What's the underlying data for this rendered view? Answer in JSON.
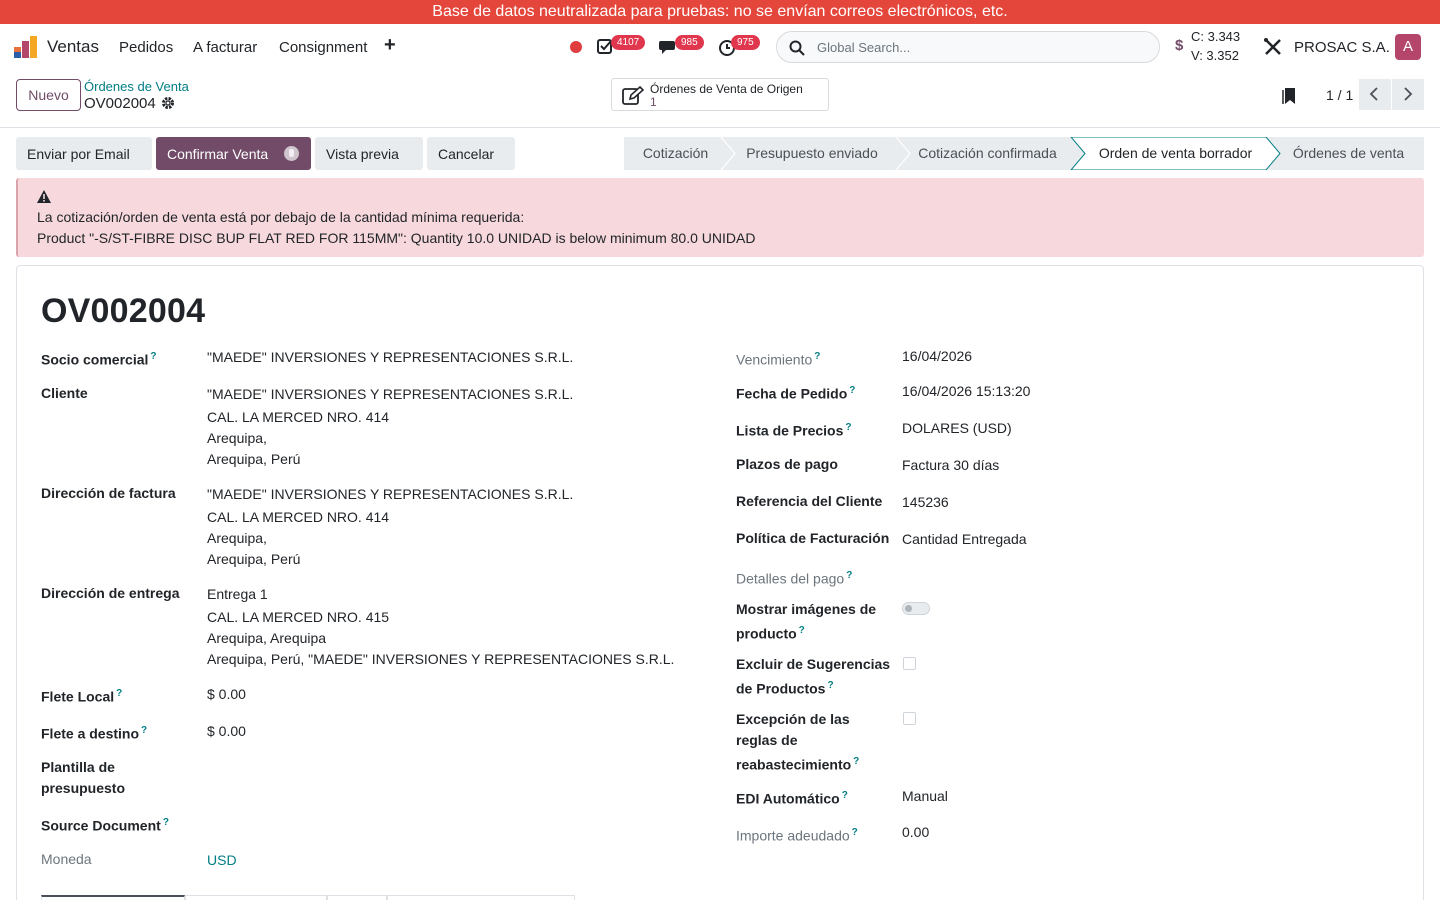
{
  "banner": "Base de datos neutralizada para pruebas: no se envían correos electrónicos, etc.",
  "navbar": {
    "app_name": "Ventas",
    "menu": [
      "Pedidos",
      "A facturar",
      "Consignment"
    ],
    "badges": {
      "activities": "4107",
      "messages": "985",
      "clock": "975"
    },
    "search_placeholder": "Global Search...",
    "currency_symbol": "$",
    "rate_buy": "C: 3.343",
    "rate_sell": "V: 3.352",
    "company": "PROSAC S.A.",
    "avatar_letter": "A"
  },
  "control": {
    "new_label": "Nuevo",
    "breadcrumb_parent": "Órdenes de Venta",
    "breadcrumb_current": "OV002004",
    "smart_button_label": "Órdenes de Venta de Origen",
    "smart_button_count": "1",
    "pager": "1 / 1"
  },
  "actions": [
    "Enviar por Email",
    "Confirmar Venta",
    "Vista previa",
    "Cancelar"
  ],
  "stages": [
    {
      "label": "Cotización",
      "active": false
    },
    {
      "label": "Presupuesto enviado",
      "active": false
    },
    {
      "label": "Cotización confirmada",
      "active": false
    },
    {
      "label": "Orden de venta borrador",
      "active": true
    },
    {
      "label": "Órdenes de venta",
      "active": false
    }
  ],
  "alert": {
    "line1": "La cotización/orden de venta está por debajo de la cantidad mínima requerida:",
    "line2": "Product \"-S/ST-FIBRE DISC BUP FLAT RED FOR 115MM\": Quantity 10.0 UNIDAD is below minimum 80.0 UNIDAD"
  },
  "form": {
    "title": "OV002004",
    "left": {
      "socio_label": "Socio comercial",
      "socio_value": "\"MAEDE\" INVERSIONES Y REPRESENTACIONES S.R.L.",
      "cliente_label": "Cliente",
      "cliente_lines": [
        "\"MAEDE\" INVERSIONES Y REPRESENTACIONES S.R.L.",
        "CAL. LA MERCED NRO. 414",
        "Arequipa,",
        "Arequipa, Perú"
      ],
      "factura_label": "Dirección de factura",
      "factura_lines": [
        "\"MAEDE\" INVERSIONES Y REPRESENTACIONES S.R.L.",
        "CAL. LA MERCED NRO. 414",
        "Arequipa,",
        "Arequipa, Perú"
      ],
      "entrega_label": "Dirección de entrega",
      "entrega_lines": [
        "Entrega 1",
        "CAL. LA MERCED NRO. 415",
        "Arequipa, Arequipa",
        "Arequipa, Perú, \"MAEDE\" INVERSIONES Y REPRESENTACIONES S.R.L."
      ],
      "flete_local_label": "Flete Local",
      "flete_local_value": "$ 0.00",
      "flete_destino_label": "Flete a destino",
      "flete_destino_value": "$ 0.00",
      "plantilla_label_1": "Plantilla de",
      "plantilla_label_2": "presupuesto",
      "source_label": "Source Document",
      "moneda_label": "Moneda",
      "moneda_value": "USD"
    },
    "right": {
      "vencimiento_label": "Vencimiento",
      "vencimiento_value": "16/04/2026",
      "fecha_label": "Fecha de Pedido",
      "fecha_value": "16/04/2026 15:13:20",
      "lista_label": "Lista de Precios",
      "lista_value": "DOLARES (USD)",
      "plazos_label": "Plazos de pago",
      "plazos_value": "Factura 30 días",
      "referencia_label": "Referencia del Cliente",
      "referencia_value": "145236",
      "politica_label": "Política de Facturación",
      "politica_value": "Cantidad Entregada",
      "detalles_label": "Detalles del pago",
      "mostrar_label_1": "Mostrar imágenes de",
      "mostrar_label_2": "producto",
      "mostrar_checked": false,
      "excluir_label_1": "Excluir de Sugerencias",
      "excluir_label_2": "de Productos",
      "excluir_checked": false,
      "excepcion_label_1": "Excepción de las",
      "excepcion_label_2": "reglas de",
      "excepcion_label_3": "reabastecimiento",
      "excepcion_checked": false,
      "edi_label": "EDI Automático",
      "edi_value": "Manual",
      "importe_label": "Importe adeudado",
      "importe_value": "0.00"
    },
    "help_mark": "?"
  },
  "colors": {
    "brand": "#714b67",
    "link": "#017e84",
    "banner": "#e5463b",
    "alert_bg": "#f7d9dd",
    "badge": "#e0364e"
  }
}
